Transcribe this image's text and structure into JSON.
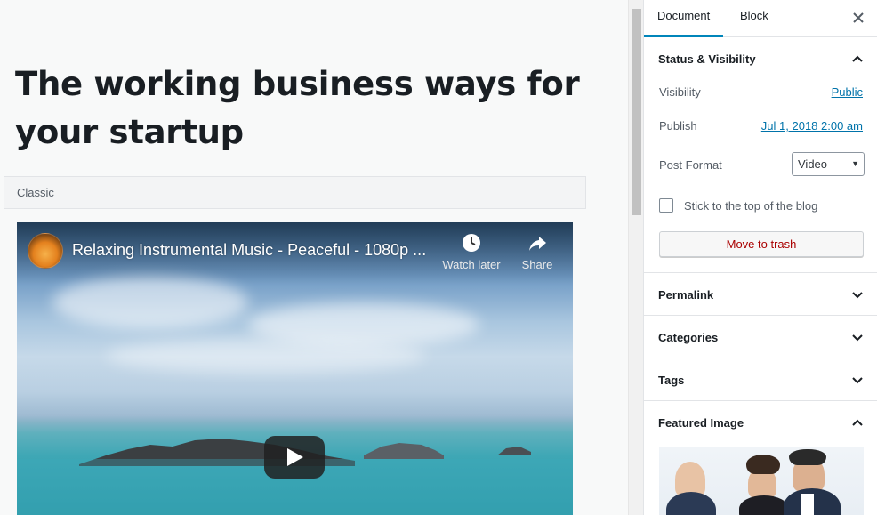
{
  "editor": {
    "title": "The working business ways for your startup",
    "classic_label": "Classic"
  },
  "video": {
    "title": "Relaxing Instrumental Music - Peaceful - 1080p ...",
    "watch_later": "Watch later",
    "share": "Share"
  },
  "sidebar": {
    "tabs": [
      "Document",
      "Block"
    ],
    "status_panel": {
      "title": "Status & Visibility",
      "visibility_label": "Visibility",
      "visibility_value": "Public",
      "publish_label": "Publish",
      "publish_value": "Jul 1, 2018 2:00 am",
      "format_label": "Post Format",
      "format_value": "Video",
      "sticky_label": "Stick to the top of the blog",
      "sticky_checked": false,
      "trash_label": "Move to trash"
    },
    "panels": [
      "Permalink",
      "Categories",
      "Tags",
      "Featured Image"
    ]
  },
  "colors": {
    "accent": "#0085ba",
    "link": "#0073aa",
    "trash": "#aa0000"
  }
}
